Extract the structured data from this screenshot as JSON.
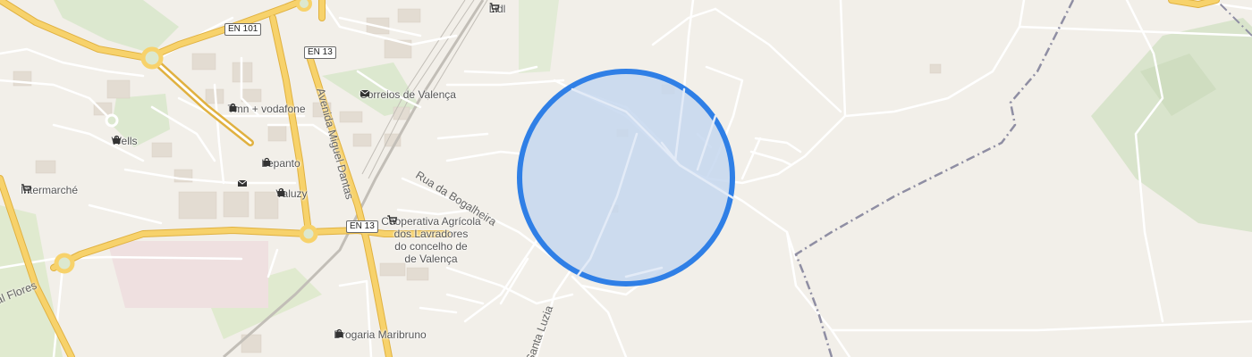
{
  "map": {
    "colors": {
      "background": "#f2efe9",
      "park": "#dce8cf",
      "main_road": "#f7d26b",
      "main_road_casing": "#e0b140",
      "minor_road": "#ffffff",
      "railway": "#bdbab5",
      "boundary": "#8f8ea3",
      "accuracy_fill": "#c6d7ee",
      "accuracy_stroke": "#2f7fe6"
    },
    "road_shields": [
      {
        "id": "en101",
        "label": "EN 101"
      },
      {
        "id": "en13-north",
        "label": "EN 13"
      },
      {
        "id": "en13-south",
        "label": "EN 13"
      }
    ],
    "streets": [
      {
        "id": "avenida-miguel-dantas",
        "label": "Avenida Miguel Dantas"
      },
      {
        "id": "rua-da-bogalheira",
        "label": "Rua da Bogalheira"
      },
      {
        "id": "santa-luzia",
        "label": "Santa Luzia"
      },
      {
        "id": "flores",
        "label": "al Flores"
      }
    ],
    "pois": [
      {
        "id": "lidl",
        "label": "Lidl",
        "icon": "shopping-cart-icon"
      },
      {
        "id": "correios",
        "label": "Correios de Valença",
        "icon": "mail-icon"
      },
      {
        "id": "tmn-vodafone",
        "label": "Tmn + vodafone",
        "icon": "shopping-bag-icon"
      },
      {
        "id": "wells",
        "label": "Wells",
        "icon": "shopping-bag-icon"
      },
      {
        "id": "intermarche",
        "label": "Intermarché",
        "icon": "shopping-cart-icon"
      },
      {
        "id": "lepanto",
        "label": "Lepanto",
        "icon": "shopping-bag-icon"
      },
      {
        "id": "valuzy",
        "label": "Valuzy",
        "icon": "shopping-bag-icon"
      },
      {
        "id": "cooperativa",
        "label": "Cooperativa Agrícola\ndos Lavradores\ndo concelho de\nde Valença",
        "icon": "shopping-cart-icon"
      },
      {
        "id": "drogaria",
        "label": "Drogaria Maribruno",
        "icon": "shopping-bag-icon"
      },
      {
        "id": "post-small",
        "label": "",
        "icon": "mail-icon"
      }
    ]
  }
}
